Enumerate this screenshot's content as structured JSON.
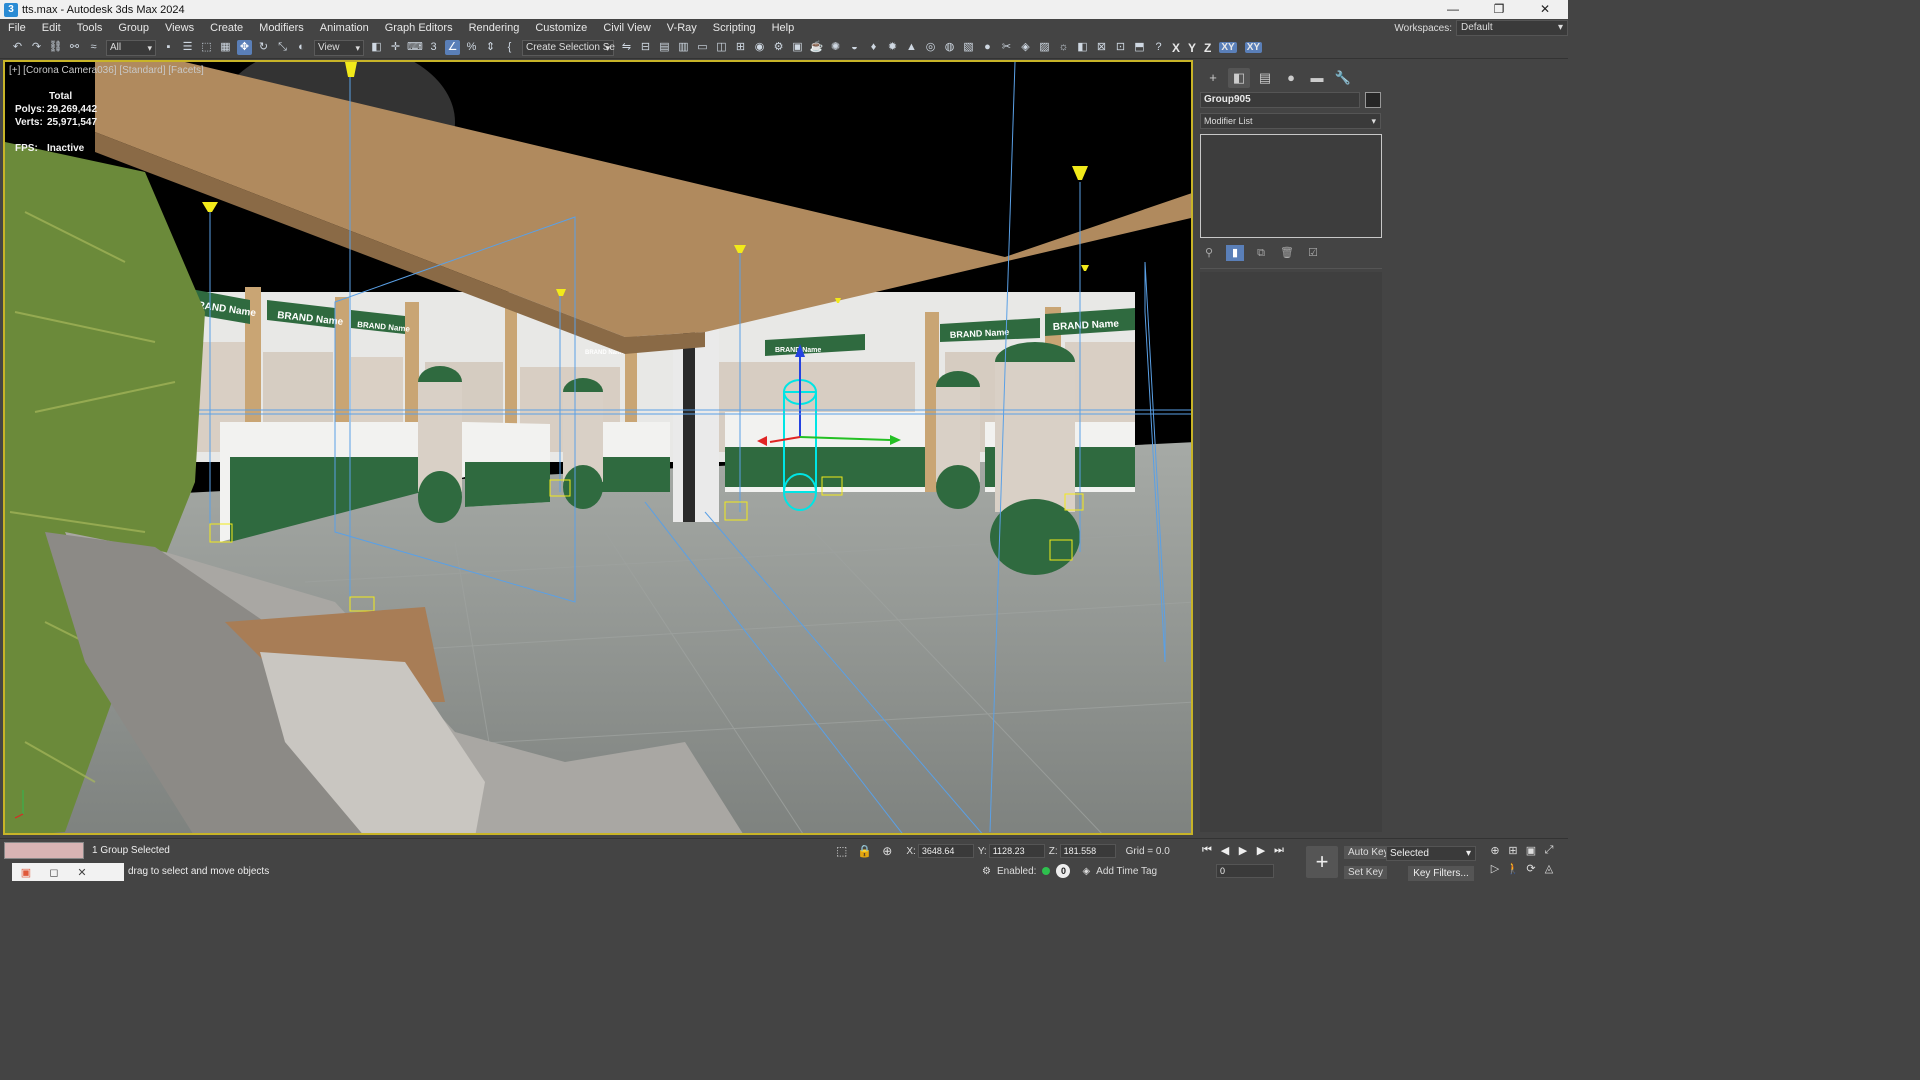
{
  "window": {
    "title": "tts.max - Autodesk 3ds Max 2024",
    "app_icon": "3",
    "buttons": [
      "—",
      "❐",
      "✕"
    ]
  },
  "menu": {
    "items": [
      "File",
      "Edit",
      "Tools",
      "Group",
      "Views",
      "Create",
      "Modifiers",
      "Animation",
      "Graph Editors",
      "Rendering",
      "Customize",
      "Civil View",
      "V-Ray",
      "Scripting",
      "Help"
    ],
    "workspaces_label": "Workspaces:",
    "workspace_value": "Default"
  },
  "toolbar": {
    "filter_value": "All",
    "refcoord_value": "View",
    "selection_set": "Create Selection Se",
    "axis_x": "X",
    "axis_y": "Y",
    "axis_z": "Z",
    "axis_xy": "XY",
    "axis_xy2": "XY"
  },
  "viewport": {
    "label": "[+] [Corona Camera036] [Standard] [Facets]",
    "stats": {
      "total_label": "Total",
      "polys_label": "Polys:",
      "polys_value": "29,269,442",
      "verts_label": "Verts:",
      "verts_value": "25,971,547",
      "fps_label": "FPS:",
      "fps_value": "Inactive"
    },
    "signs": [
      "BRAND Name",
      "BRAND Name",
      "BRAND Name",
      "BRAND Name",
      "BRAND Name",
      "BRAND Name",
      "BRAND Name"
    ],
    "colors": {
      "beam": "#b08a5e",
      "floor": "#8f9390",
      "green": "#2f6a3f",
      "wire": "#5aa0e6",
      "light": "#f2ea1a"
    }
  },
  "command_panel": {
    "object_name": "Group905",
    "modifier_list": "Modifier List",
    "tabs": [
      "create-icon",
      "modify-icon",
      "hierarchy-icon",
      "motion-icon",
      "display-icon",
      "utilities-icon"
    ]
  },
  "status": {
    "selection": "1 Group Selected",
    "prompt": "drag to select and move objects",
    "x_label": "X:",
    "x_value": "3648.64",
    "y_label": "Y:",
    "y_value": "1128.23",
    "z_label": "Z:",
    "z_value": "181.558",
    "grid": "Grid = 0.0",
    "enabled": "Enabled:",
    "enabled_value": "0",
    "add_time_tag": "Add Time Tag"
  },
  "animation": {
    "frame": "0",
    "auto_key": "Auto Key",
    "set_key": "Set Key",
    "key_mode": "Selected",
    "key_filters": "Key Filters..."
  }
}
